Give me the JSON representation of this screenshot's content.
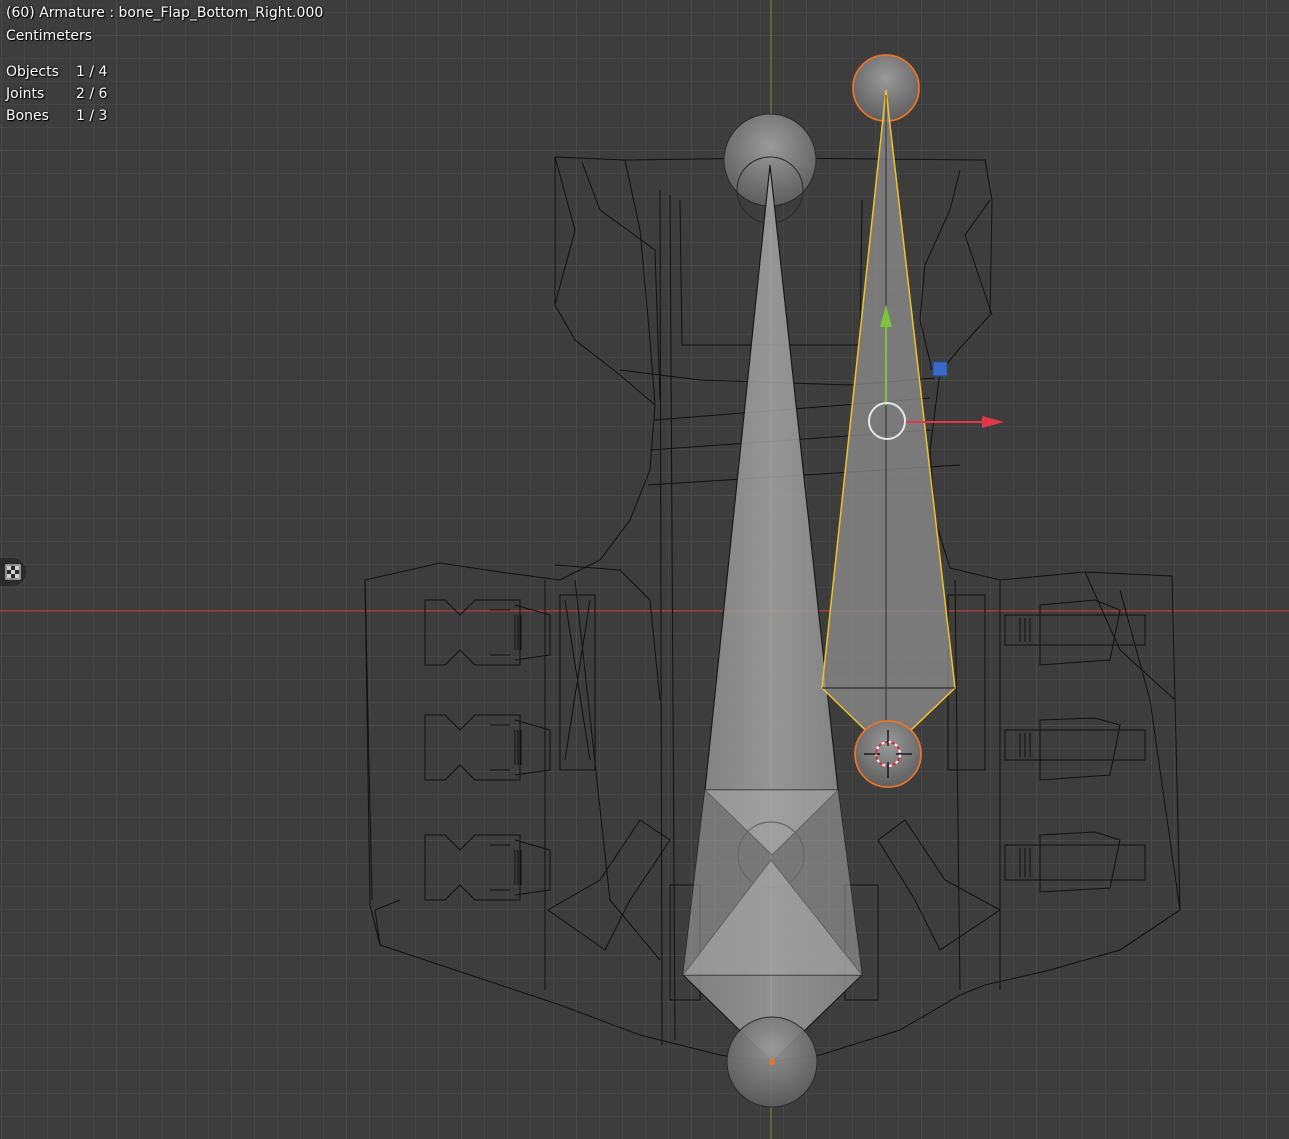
{
  "viewport": {
    "header_title": "(60) Armature : bone_Flap_Bottom_Right.000",
    "units": "Centimeters",
    "stats": [
      {
        "label": "Objects",
        "value": "1 / 4"
      },
      {
        "label": "Joints",
        "value": "2 / 6"
      },
      {
        "label": "Bones",
        "value": "1 / 3"
      }
    ]
  },
  "colors": {
    "background": "#3d3d3d",
    "x_axis": "#c83a3a",
    "y_axis": "#6a9a28",
    "selected_bone_outline": "#f0c030",
    "selected_joint": "#e8742a",
    "gizmo_x": "#e0384a",
    "gizmo_y": "#7ec43a",
    "gizmo_plane": "#3a6ac4"
  },
  "icons": {
    "side_toggle": "checker-icon",
    "cursor": "3d-cursor-icon"
  }
}
